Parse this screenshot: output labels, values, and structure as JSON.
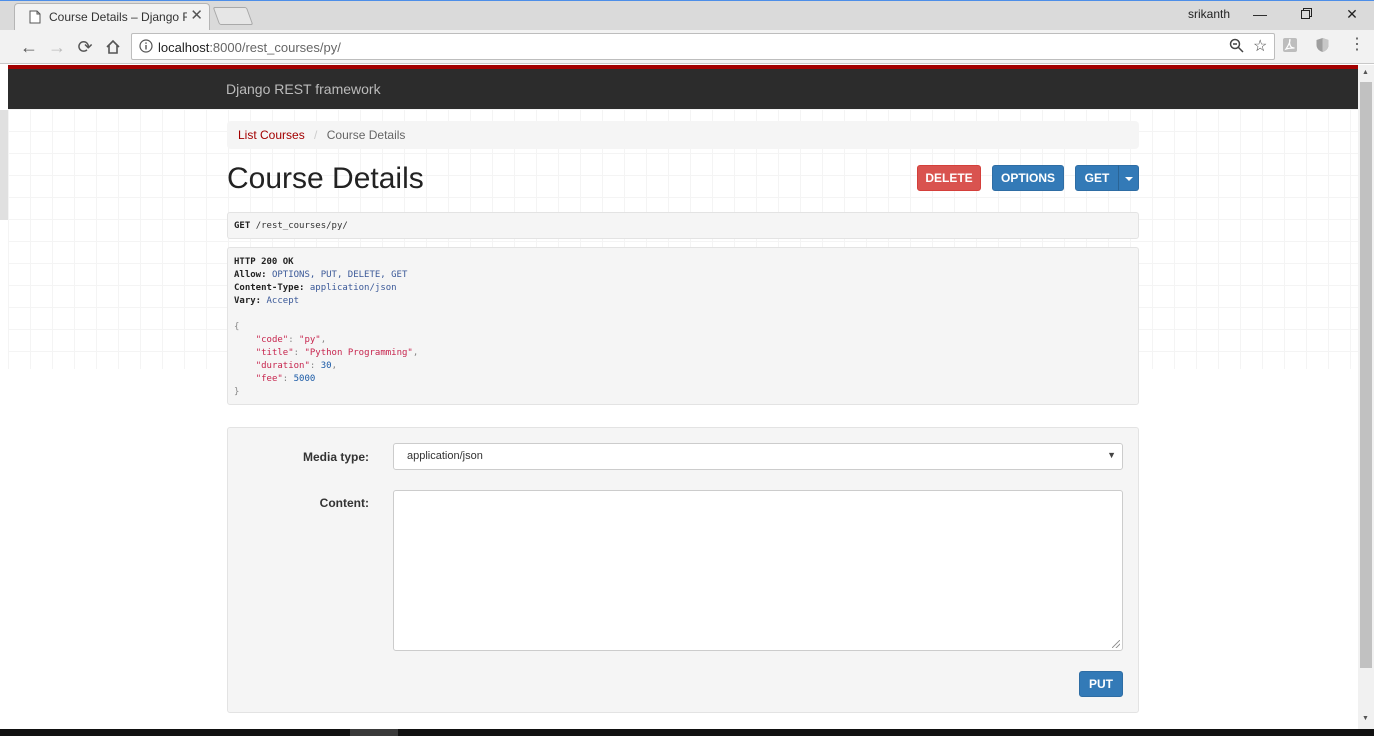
{
  "browser": {
    "tab_title": "Course Details – Django REST framework",
    "user": "srikanth",
    "url_host": "localhost",
    "url_rest": ":8000/rest_courses/py/"
  },
  "page": {
    "brand": "Django REST framework",
    "breadcrumb": {
      "link": "List Courses",
      "sep": "/",
      "active": "Course Details"
    },
    "title": "Course Details",
    "buttons": {
      "delete": "DELETE",
      "options": "OPTIONS",
      "get": "GET",
      "put": "PUT"
    },
    "request": {
      "method": "GET",
      "path": "/rest_courses/py/"
    },
    "response": {
      "status": "HTTP 200 OK",
      "headers": [
        {
          "key": "Allow:",
          "value": "OPTIONS, PUT, DELETE, GET"
        },
        {
          "key": "Content-Type:",
          "value": "application/json"
        },
        {
          "key": "Vary:",
          "value": "Accept"
        }
      ],
      "open_brace": "{",
      "close_brace": "}",
      "body": [
        {
          "key": "\"code\"",
          "value": "\"py\"",
          "type": "string",
          "comma": ","
        },
        {
          "key": "\"title\"",
          "value": "\"Python Programming\"",
          "type": "string",
          "comma": ","
        },
        {
          "key": "\"duration\"",
          "value": "30",
          "type": "number",
          "comma": ","
        },
        {
          "key": "\"fee\"",
          "value": "5000",
          "type": "number",
          "comma": ""
        }
      ]
    },
    "form": {
      "media_label": "Media type:",
      "media_value": "application/json",
      "content_label": "Content:",
      "content_value": ""
    }
  },
  "colors": {
    "navbar": "#2c2c2c",
    "accent": "#a30000",
    "danger": "#d9534f",
    "primary": "#337ab7"
  }
}
